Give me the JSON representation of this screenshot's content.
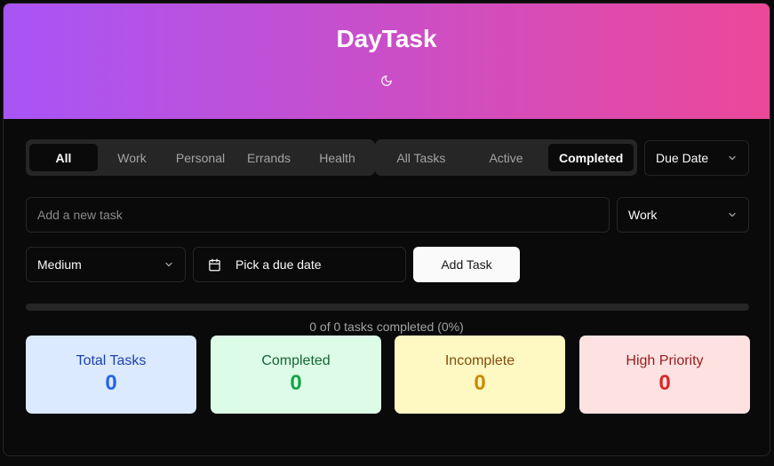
{
  "app": {
    "title": "DayTask",
    "theme_icon": "moon-icon"
  },
  "category_tabs": [
    {
      "label": "All",
      "active": true
    },
    {
      "label": "Work",
      "active": false
    },
    {
      "label": "Personal",
      "active": false
    },
    {
      "label": "Errands",
      "active": false
    },
    {
      "label": "Health",
      "active": false
    }
  ],
  "status_tabs": [
    {
      "label": "All Tasks",
      "active": false
    },
    {
      "label": "Active",
      "active": false
    },
    {
      "label": "Completed",
      "active": true
    }
  ],
  "sort_select": {
    "value": "Due Date"
  },
  "new_task": {
    "placeholder": "Add a new task",
    "value": "",
    "category_select": "Work",
    "priority_select": "Medium",
    "due_date_placeholder": "Pick a due date",
    "add_label": "Add Task"
  },
  "progress": {
    "fraction": 0,
    "text": "0 of 0 tasks completed (0%)"
  },
  "stats": [
    {
      "label": "Total Tasks",
      "value": "0",
      "bg": "#dbeafe",
      "label_color": "#1e40af",
      "value_color": "#2563eb"
    },
    {
      "label": "Completed",
      "value": "0",
      "bg": "#dcfce7",
      "label_color": "#166534",
      "value_color": "#16a34a"
    },
    {
      "label": "Incomplete",
      "value": "0",
      "bg": "#fef9c3",
      "label_color": "#854d0e",
      "value_color": "#ca8a04"
    },
    {
      "label": "High Priority",
      "value": "0",
      "bg": "#fee2e2",
      "label_color": "#991b1b",
      "value_color": "#dc2626"
    }
  ],
  "colors": {
    "header_gradient_start": "#a855f7",
    "header_gradient_end": "#ec4899",
    "background": "#0a0a0a",
    "muted": "#262626"
  }
}
